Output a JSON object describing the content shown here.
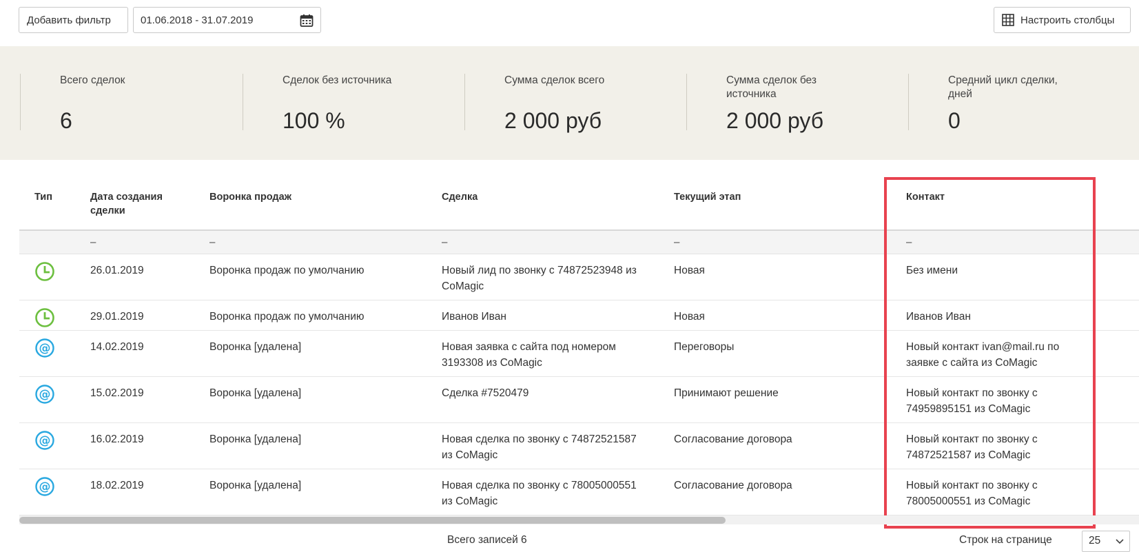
{
  "toolbar": {
    "add_filter_label": "Добавить фильтр",
    "date_range": "01.06.2018 - 31.07.2019",
    "columns_label": "Настроить столбцы"
  },
  "stats": [
    {
      "label": "Всего сделок",
      "value": "6"
    },
    {
      "label": "Сделок без источника",
      "value": "100 %"
    },
    {
      "label": "Сумма сделок всего",
      "value": "2 000 руб"
    },
    {
      "label": "Сумма сделок без источника",
      "value": "2 000 руб"
    },
    {
      "label": "Средний цикл сделки, дней",
      "value": "0"
    }
  ],
  "table": {
    "headers": {
      "type": "Тип",
      "created": "Дата создания сделки",
      "funnel": "Воронка продаж",
      "deal": "Сделка",
      "stage": "Текущий этап",
      "contact": "Контакт"
    },
    "filter_placeholder": "–",
    "rows": [
      {
        "type": "clock",
        "created": "26.01.2019",
        "funnel": "Воронка продаж по умолчанию",
        "deal": "Новый лид по звонку с 74872523948 из CoMagic",
        "stage": "Новая",
        "contact": "Без имени"
      },
      {
        "type": "clock",
        "created": "29.01.2019",
        "funnel": "Воронка продаж по умолчанию",
        "deal": "Иванов Иван",
        "stage": "Новая",
        "contact": "Иванов Иван"
      },
      {
        "type": "at",
        "created": "14.02.2019",
        "funnel": "Воронка [удалена]",
        "deal": "Новая заявка с сайта под номером 3193308 из CoMagic",
        "stage": "Переговоры",
        "contact": "Новый контакт ivan@mail.ru по заявке с сайта из CoMagic"
      },
      {
        "type": "at",
        "created": "15.02.2019",
        "funnel": "Воронка [удалена]",
        "deal": "Сделка #7520479",
        "stage": "Принимают решение",
        "contact": "Новый контакт по звонку с 74959895151 из CoMagic"
      },
      {
        "type": "at",
        "created": "16.02.2019",
        "funnel": "Воронка [удалена]",
        "deal": "Новая сделка по звонку с 74872521587 из CoMagic",
        "stage": "Согласование договора",
        "contact": "Новый контакт по звонку с 74872521587 из CoMagic"
      },
      {
        "type": "at",
        "created": "18.02.2019",
        "funnel": "Воронка [удалена]",
        "deal": "Новая сделка по звонку с 78005000551 из CoMagic",
        "stage": "Согласование договора",
        "contact": "Новый контакт по звонку с 78005000551 из CoMagic"
      }
    ]
  },
  "footer": {
    "total": "Всего записей 6",
    "rows_per_page_label": "Строк на странице",
    "rows_per_page_value": "25"
  },
  "colors": {
    "stats_bg": "#f2f0e9",
    "clock_icon": "#6cbf3f",
    "at_icon": "#29a8e0",
    "highlight": "#e8424f"
  }
}
